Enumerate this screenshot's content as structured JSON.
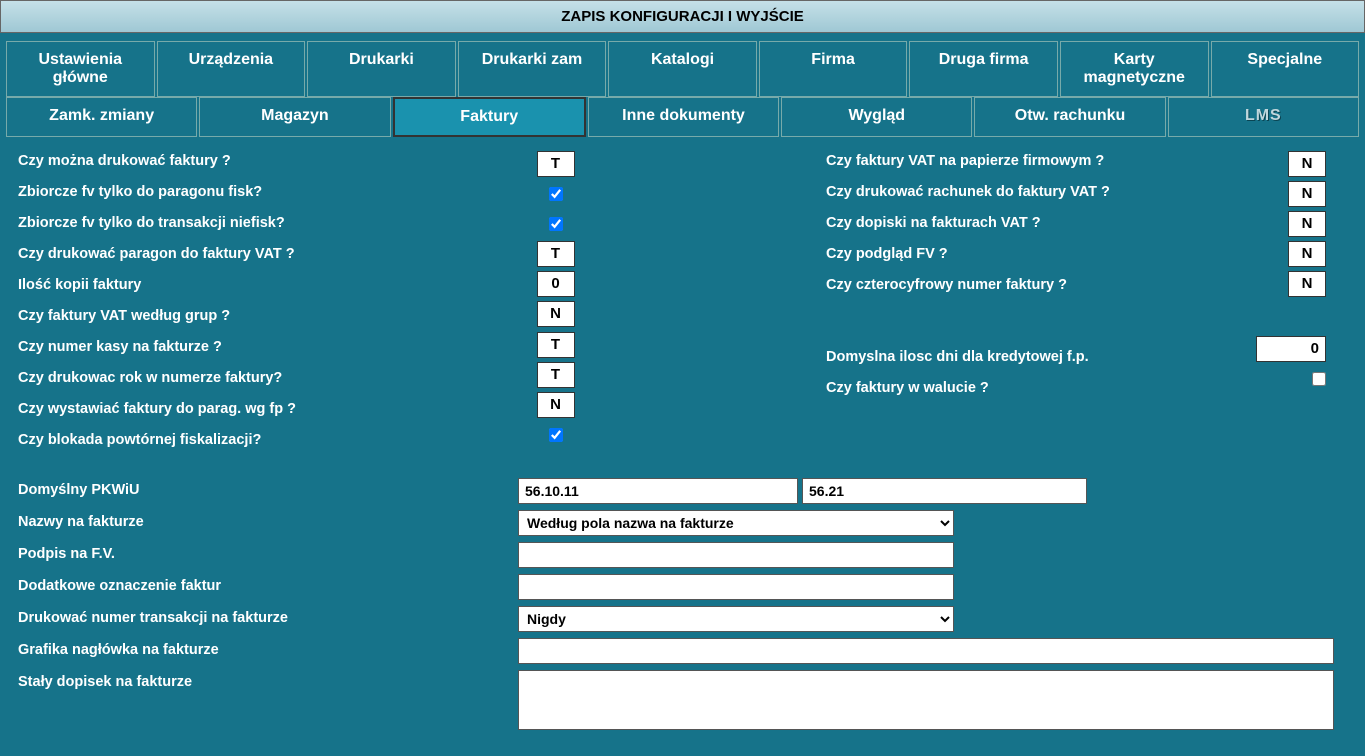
{
  "header": {
    "title": "ZAPIS KONFIGURACJI I WYJŚCIE"
  },
  "tabs": {
    "row1": [
      "Ustawienia główne",
      "Urządzenia",
      "Drukarki",
      "Drukarki zam",
      "Katalogi",
      "Firma",
      "Druga firma",
      "Karty magnetyczne",
      "Specjalne"
    ],
    "row2": [
      "Zamk. zmiany",
      "Magazyn",
      "Faktury",
      "Inne dokumenty",
      "Wygląd",
      "Otw. rachunku",
      "LMS"
    ],
    "active": "Faktury"
  },
  "left": {
    "l0": "Czy można drukować faktury ?",
    "l1": "Zbiorcze fv tylko do paragonu fisk?",
    "l2": "Zbiorcze fv tylko do transakcji niefisk?",
    "l3": "Czy drukować paragon do faktury VAT ?",
    "l4": "Ilość kopii faktury",
    "l5": "Czy faktury VAT według grup ?",
    "l6": "Czy numer kasy na fakturze ?",
    "l7": "Czy drukowac rok w numerze faktury?",
    "l8": "Czy wystawiać faktury do parag. wg fp ?",
    "l9": "Czy blokada powtórnej fiskalizacji?",
    "v0": "T",
    "v3": "T",
    "v4": "0",
    "v5": "N",
    "v6": "T",
    "v7": "T",
    "v8": "N"
  },
  "right": {
    "r0": "Czy faktury VAT na papierze firmowym ?",
    "r1": "Czy drukować rachunek do faktury VAT ?",
    "r2": "Czy dopiski na fakturach VAT ?",
    "r3": "Czy podgląd FV ?",
    "r4": "Czy czterocyfrowy  numer faktury ?",
    "r5": "Domyslna ilosc dni dla kredytowej f.p.",
    "r6": "Czy faktury w walucie ?",
    "w0": "N",
    "w1": "N",
    "w2": "N",
    "w3": "N",
    "w4": "N",
    "w5": "0"
  },
  "bottom": {
    "b0": "Domyślny PKWiU",
    "b1": "Nazwy na fakturze",
    "b2": "Podpis na F.V.",
    "b3": "Dodatkowe oznaczenie faktur",
    "b4": "Drukować numer transakcji na fakturze",
    "b5": "Grafika nagłówka na fakturze",
    "b6": "Stały dopisek na fakturze",
    "pkw1": "56.10.11",
    "pkw2": "56.21",
    "names": "Według pola nazwa na fakturze",
    "podpis": "",
    "dodatkowe": "",
    "numtrans": "Nigdy",
    "grafika": "",
    "dopisek": ""
  }
}
